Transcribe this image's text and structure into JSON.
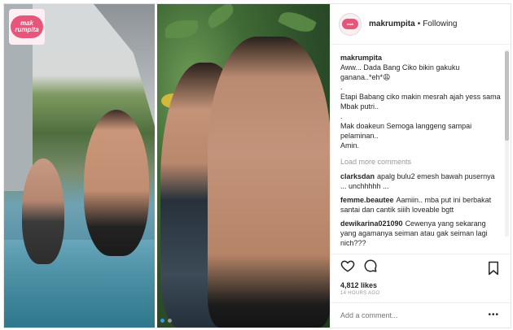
{
  "logo": {
    "text": "mak rumpita"
  },
  "header": {
    "username": "makrumpita",
    "separator": "•",
    "follow": "Following"
  },
  "caption": {
    "username": "makrumpita",
    "lines": [
      "Aww... Dada Bang Ciko bikin gakuku ganana..*eh*😩",
      ".",
      "Etapi Babang ciko makin mesrah ajah yess sama Mbak putri..",
      ".",
      "Mak doakeun Semoga langgeng sampai pelaminan..",
      "Amin."
    ]
  },
  "load_more": "Load more comments",
  "comments": [
    {
      "user": "clarksdan",
      "text": "apalg bulu2 emesh bawah pusernya ... unchhhhh ..."
    },
    {
      "user": "femme.beautee",
      "text": "Aamiin.. mba put ini berbakat santai dan cantik siiih loveable bgtt"
    },
    {
      "user": "dewikarina021090",
      "text": "Cewenya yang sekarang yang agamanya seiman atau gak seiman lagi nich???"
    }
  ],
  "likes": "4,812 likes",
  "time": "14 HOURS AGO",
  "add_comment_placeholder": "Add a comment...",
  "more_label": "•••",
  "icons": [
    "heart-icon",
    "comment-icon",
    "bookmark-icon",
    "more-options-icon"
  ],
  "colors": {
    "accent": "#3897f0",
    "brand_pink": "#e8557a"
  }
}
